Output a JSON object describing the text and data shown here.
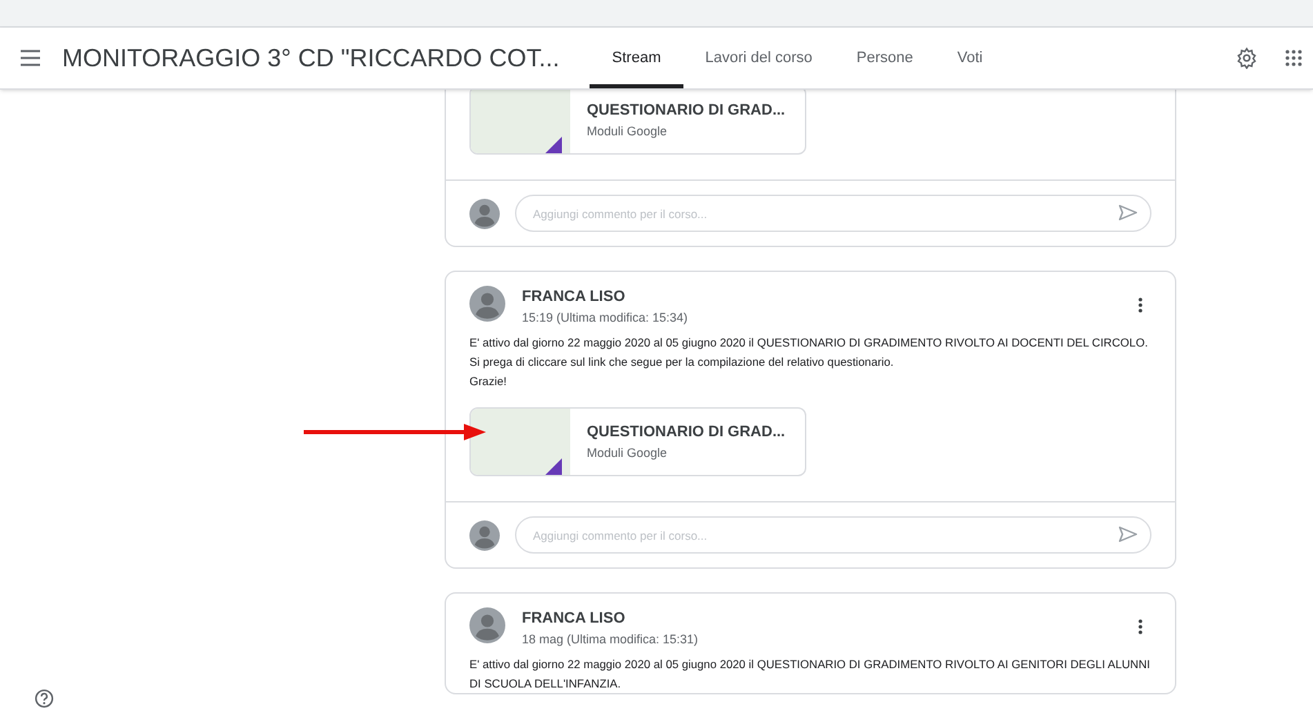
{
  "course_title": "MONITORAGGIO 3° CD \"RICCARDO COT...",
  "tabs": [
    {
      "label": "Stream",
      "selected": true
    },
    {
      "label": "Lavori del corso",
      "selected": false
    },
    {
      "label": "Persone",
      "selected": false
    },
    {
      "label": "Voti",
      "selected": false
    }
  ],
  "posts": [
    {
      "attachment": {
        "title": "QUESTIONARIO DI GRAD...",
        "type": "Moduli Google"
      },
      "comment_placeholder": "Aggiungi commento per il corso..."
    },
    {
      "author": "FRANCA LISO",
      "time": "15:19 (Ultima modifica: 15:34)",
      "body": [
        "E' attivo dal giorno 22 maggio 2020 al 05 giugno 2020 il QUESTIONARIO DI GRADIMENTO RIVOLTO AI DOCENTI DEL CIRCOLO.",
        "Si prega di cliccare sul link che segue per la compilazione del relativo questionario.",
        "Grazie!"
      ],
      "attachment": {
        "title": "QUESTIONARIO DI GRAD...",
        "type": "Moduli Google"
      },
      "comment_placeholder": "Aggiungi commento per il corso..."
    },
    {
      "author": "FRANCA LISO",
      "time": "18 mag (Ultima modifica: 15:31)",
      "body": [
        "E' attivo dal giorno 22 maggio 2020 al 05 giugno 2020 il QUESTIONARIO DI GRADIMENTO RIVOLTO AI GENITORI DEGLI ALUNNI DI SCUOLA DELL'INFANZIA."
      ]
    }
  ]
}
